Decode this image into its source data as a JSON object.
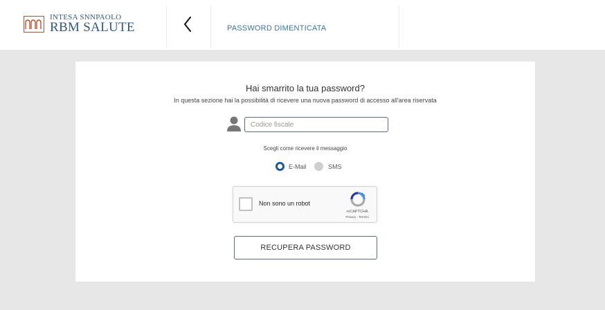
{
  "brand": {
    "line1": "INTESA SNNPAOLO",
    "line2": "RBM SALUTE",
    "color": "#2f5a84",
    "mark_color": "#c1502e"
  },
  "header": {
    "back_icon": "chevron-left-icon",
    "title": "PASSWORD DIMENTICATA",
    "title_color": "#3c76a8"
  },
  "form": {
    "heading": "Hai smarrito la tua password?",
    "subheading": "In questa sezione hai la possibilità di ricevere una nuova password di accesso all'area riservata",
    "user_icon": "user-icon",
    "codice_fiscale": {
      "placeholder": "Codice fiscale",
      "value": ""
    },
    "delivery_label": "Scegli come ricevere il messaggio",
    "delivery_options": [
      {
        "label": "E-Mail",
        "selected": true
      },
      {
        "label": "SMS",
        "selected": false
      }
    ],
    "captcha": {
      "label": "Non sono un robot",
      "brand": "reCAPTCHA",
      "links": "Privacy - Termini",
      "checked": false
    },
    "submit_label": "RECUPERA PASSWORD"
  },
  "colors": {
    "background": "#e7e7e7",
    "accent": "#1d5c96"
  }
}
